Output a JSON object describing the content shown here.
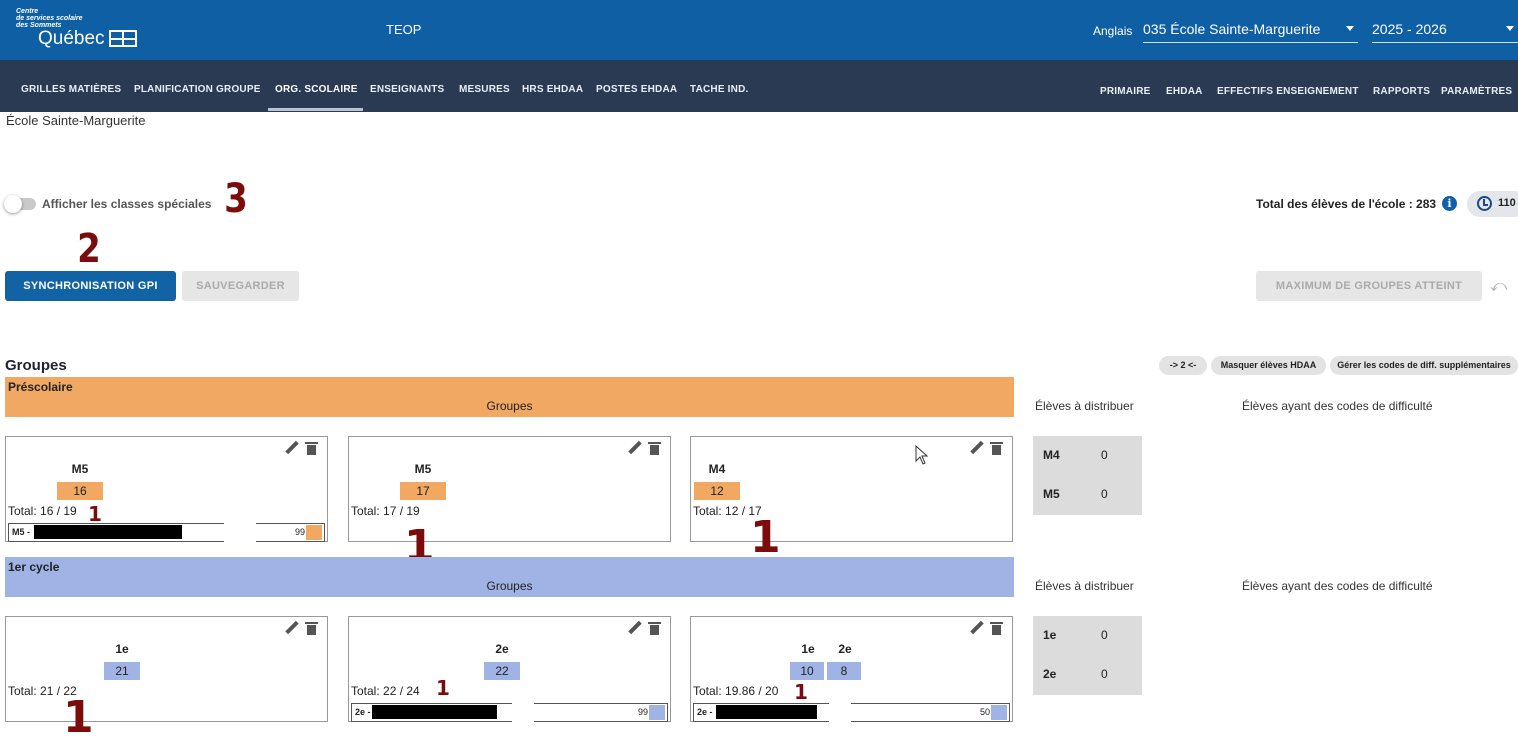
{
  "header": {
    "logo_small": [
      "Centre",
      "de services scolaire",
      "des Sommets"
    ],
    "logo_big": "Québec",
    "app_title": "TEOP",
    "language": "Anglais",
    "school_select": "035 École Sainte-Marguerite",
    "year_select": "2025 - 2026"
  },
  "nav": {
    "left": [
      "GRILLES MATIÈRES",
      "PLANIFICATION GROUPE",
      "ORG. SCOLAIRE",
      "ENSEIGNANTS",
      "MESURES",
      "HRS EHDAA",
      "POSTES EHDAA",
      "TACHE IND."
    ],
    "right": [
      "PRIMAIRE",
      "EHDAA",
      "EFFECTIFS ENSEIGNEMENT",
      "RAPPORTS",
      "PARAMÈTRES"
    ],
    "active": "ORG. SCOLAIRE"
  },
  "page": {
    "school_name": "École Sainte-Marguerite",
    "toggle_label": "Afficher les classes spéciales",
    "total_label": "Total des élèves de l'école : 283",
    "history_count": "110",
    "sync_button": "SYNCHRONISATION GPI",
    "save_button": "SAUVEGARDER",
    "max_button": "MAXIMUM DE GROUPES ATTEINT",
    "groups_title": "Groupes",
    "pill_arrows": "-> 2 <-",
    "pill_hide": "Masquer élèves HDAA",
    "pill_codes": "Gérer les codes de diff. supplémentaires",
    "col_distribute": "Élèves à distribuer",
    "col_difficulty": "Élèves ayant des codes de difficulté"
  },
  "annotations": {
    "n1": "1",
    "n2": "2",
    "n3": "3"
  },
  "sections": [
    {
      "name": "Préscolaire",
      "groups_label": "Groupes",
      "color": "#f0a862",
      "cards": [
        {
          "levels": [
            {
              "name": "M5",
              "count": "16"
            }
          ],
          "total": "Total: 16 / 19",
          "subrow": {
            "label": "M5 -",
            "value": "99"
          }
        },
        {
          "levels": [
            {
              "name": "M5",
              "count": "17"
            }
          ],
          "total": "Total: 17 / 19"
        },
        {
          "levels": [
            {
              "name": "M4",
              "count": "12"
            }
          ],
          "total": "Total: 12 / 17"
        }
      ],
      "distribute": [
        {
          "level": "M4",
          "count": "0"
        },
        {
          "level": "M5",
          "count": "0"
        }
      ]
    },
    {
      "name": "1er cycle",
      "groups_label": "Groupes",
      "color": "#9fb3e4",
      "cards": [
        {
          "levels": [
            {
              "name": "1e",
              "count": "21"
            }
          ],
          "total": "Total: 21 / 22"
        },
        {
          "levels": [
            {
              "name": "2e",
              "count": "22"
            }
          ],
          "total": "Total: 22 / 24",
          "subrow": {
            "label": "2e -",
            "value": "99"
          }
        },
        {
          "levels": [
            {
              "name": "1e",
              "count": "10"
            },
            {
              "name": "2e",
              "count": "8"
            }
          ],
          "total": "Total: 19.86 / 20",
          "subrow": {
            "label": "2e -",
            "value": "50"
          }
        }
      ],
      "distribute": [
        {
          "level": "1e",
          "count": "0"
        },
        {
          "level": "2e",
          "count": "0"
        }
      ]
    }
  ],
  "colors": {
    "topbar": "#0e5fa3",
    "navbar": "#2a3a52",
    "primary": "#1163a5",
    "annotation": "#7a0c0c"
  }
}
